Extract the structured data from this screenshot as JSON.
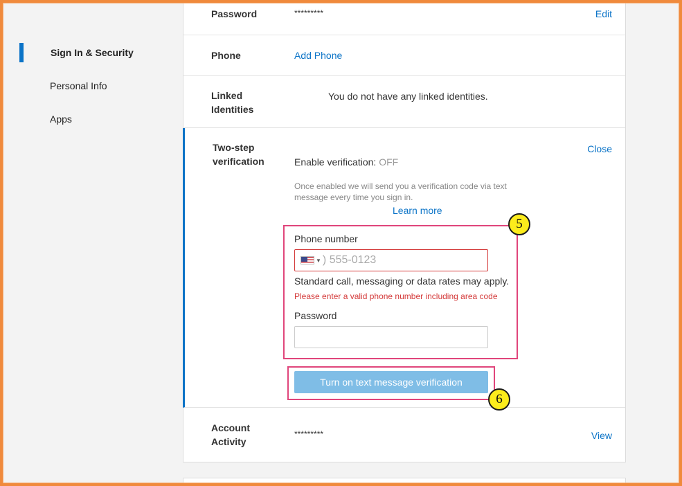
{
  "sidebar": {
    "items": [
      {
        "label": "Sign In & Security",
        "active": true
      },
      {
        "label": "Personal Info"
      },
      {
        "label": "Apps"
      }
    ]
  },
  "rows": {
    "password": {
      "title": "Password",
      "value": "*********",
      "action": "Edit"
    },
    "phone": {
      "title": "Phone",
      "action": "Add Phone"
    },
    "linked": {
      "title_1": "Linked",
      "title_2": "Identities",
      "value": "You do not have any linked identities."
    },
    "two_step": {
      "title_1": "Two-step",
      "title_2": "verification",
      "action": "Close",
      "enable_label": "Enable verification:",
      "enable_state": "OFF",
      "description": "Once enabled we will send you a verification code via text message every time you sign in.",
      "learn_more": "Learn more",
      "phone_label": "Phone number",
      "phone_placeholder": ") 555-0123",
      "rates_note": "Standard call, messaging or data rates may apply.",
      "error": "Please enter a valid phone number including area code",
      "password_label": "Password",
      "password_value": "",
      "submit": "Turn on text message verification"
    },
    "activity": {
      "title_1": "Account",
      "title_2": "Activity",
      "value": "*********",
      "action": "View"
    }
  },
  "annotations": {
    "badge_5": "5",
    "badge_6": "6"
  },
  "colors": {
    "accent": "#0a73c7",
    "error": "#d43a3a",
    "annotation": "#e0457b",
    "badge": "#fcec1c",
    "frame": "#f08a3c",
    "button": "#7fbde6"
  },
  "icons": {
    "flag": "us-flag-icon",
    "caret": "caret-down-icon"
  }
}
